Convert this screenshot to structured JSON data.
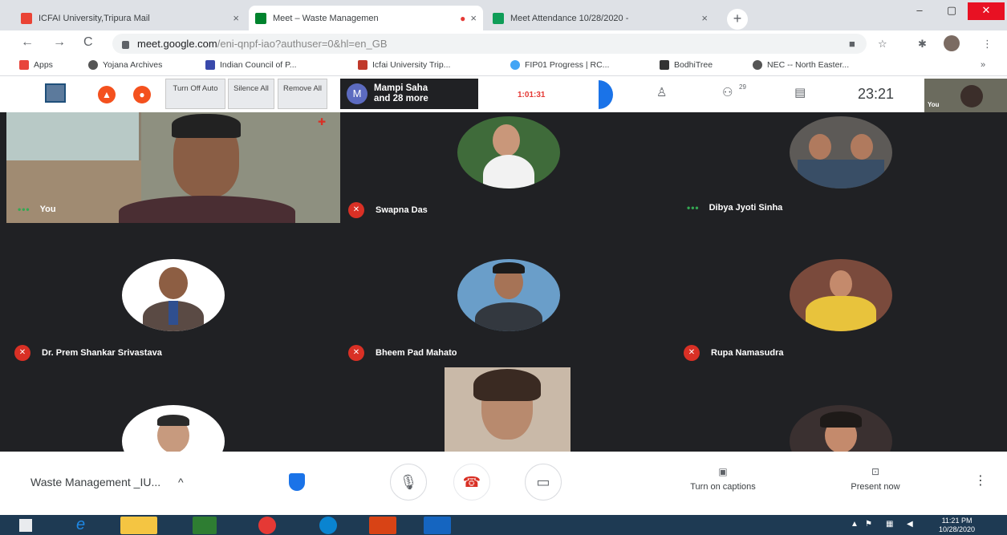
{
  "browser": {
    "tabs": [
      {
        "label": "ICFAI University,Tripura Mail",
        "icon": "gmail-icon",
        "close": "×"
      },
      {
        "label": "Meet – Waste Managemen",
        "icon": "meet-icon",
        "recording": "●",
        "close": "×",
        "active": true
      },
      {
        "label": "Meet Attendance 10/28/2020 - ",
        "icon": "sheets-icon",
        "close": "×"
      }
    ],
    "new_tab": "+",
    "window_controls": {
      "minimize": "–",
      "restore": "▢",
      "close": "✕"
    },
    "nav": {
      "back": "←",
      "forward": "→",
      "reload": "C"
    },
    "url_host": "meet.google.com",
    "url_rest": "/eni-qnpf-iao?authuser=0&hl=en_GB",
    "bookmarks": [
      {
        "label": "Apps",
        "icon": "apps-icon"
      },
      {
        "label": "Yojana Archives",
        "icon": "globe-icon"
      },
      {
        "label": "Indian Council of P...",
        "icon": "bookmark-icon"
      },
      {
        "label": "Icfai University Trip...",
        "icon": "bookmark-icon"
      },
      {
        "label": "FIP01 Progress | RC...",
        "icon": "globe-icon"
      },
      {
        "label": "BodhiTree",
        "icon": "bookmark-icon"
      },
      {
        "label": "NEC -- North Easter...",
        "icon": "globe-icon"
      }
    ]
  },
  "meet_toolbar": {
    "turn_off_auto": "Turn Off Auto",
    "silence_all": "Silence All",
    "remove_all": "Remove All",
    "presenter_initial": "M",
    "presenter_line1": "Mampi Saha",
    "presenter_line2": "and 28 more",
    "timer": "1:01:31",
    "participants_count": "29",
    "clock": "23:21",
    "self_label": "You"
  },
  "tiles": [
    {
      "name": "You",
      "status": "speaking"
    },
    {
      "name": "Swapna Das",
      "status": "muted"
    },
    {
      "name": "Dibya Jyoti Sinha",
      "status": "speaking"
    },
    {
      "name": "Dr. Prem Shankar Srivastava",
      "status": "muted"
    },
    {
      "name": "Bheem Pad Mahato",
      "status": "muted"
    },
    {
      "name": "Rupa Namasudra",
      "status": "muted"
    }
  ],
  "bottom_bar": {
    "meeting_name": "Waste Management _IU...",
    "chevron": "^",
    "captions_label": "Turn on captions",
    "present_label": "Present now",
    "more": "⋮"
  },
  "taskbar": {
    "time": "11:21 PM",
    "date": "10/28/2020"
  },
  "colors": {
    "meet_dark": "#202124",
    "tile": "#3c4043",
    "mute_red": "#d93025",
    "speaking_green": "#34a853",
    "taskbar": "#1e3a53"
  }
}
